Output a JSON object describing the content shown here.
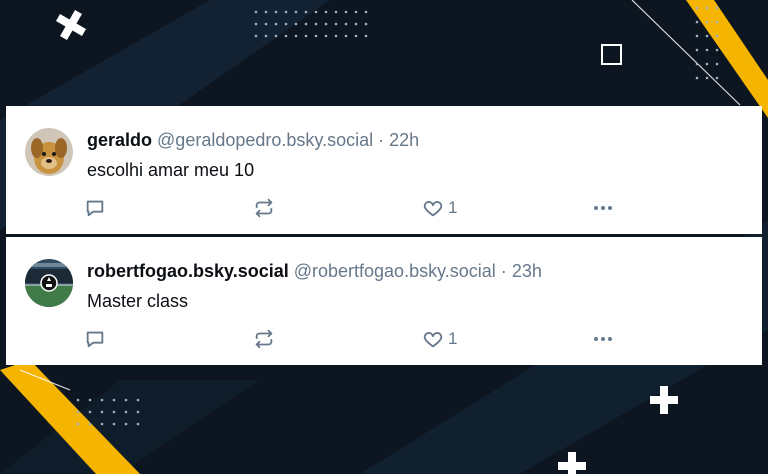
{
  "posts": [
    {
      "display_name": "geraldo",
      "handle": "@geraldopedro.bsky.social",
      "separator": "·",
      "time": "22h",
      "text": "escolhi amar meu 10",
      "like_count": "1",
      "avatar_icon": "dog-avatar-icon"
    },
    {
      "display_name": "robertfogao.bsky.social",
      "handle": "@robertfogao.bsky.social",
      "separator": "·",
      "time": "23h",
      "text": "Master class",
      "like_count": "1",
      "avatar_icon": "stadium-avatar-icon"
    }
  ],
  "colors": {
    "background": "#0c1520",
    "accent": "#f5b400",
    "card": "#ffffff",
    "muted_text": "#66788a"
  }
}
